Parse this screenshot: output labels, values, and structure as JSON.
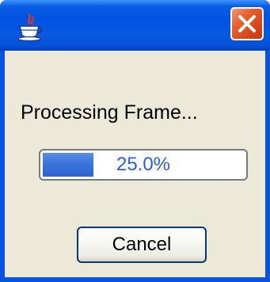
{
  "window": {
    "title_icon": "java-cup-icon",
    "close_icon": "close-icon"
  },
  "dialog": {
    "message": "Processing Frame...",
    "progress": {
      "fraction": 0.25,
      "text": "25.0%"
    },
    "cancel_label": "Cancel"
  },
  "colors": {
    "title_bar": "#0054e3",
    "close_button": "#e5602f",
    "client_bg": "#ece9d8",
    "progress_fill": "#3a74da",
    "progress_text": "#2a5fd0"
  }
}
